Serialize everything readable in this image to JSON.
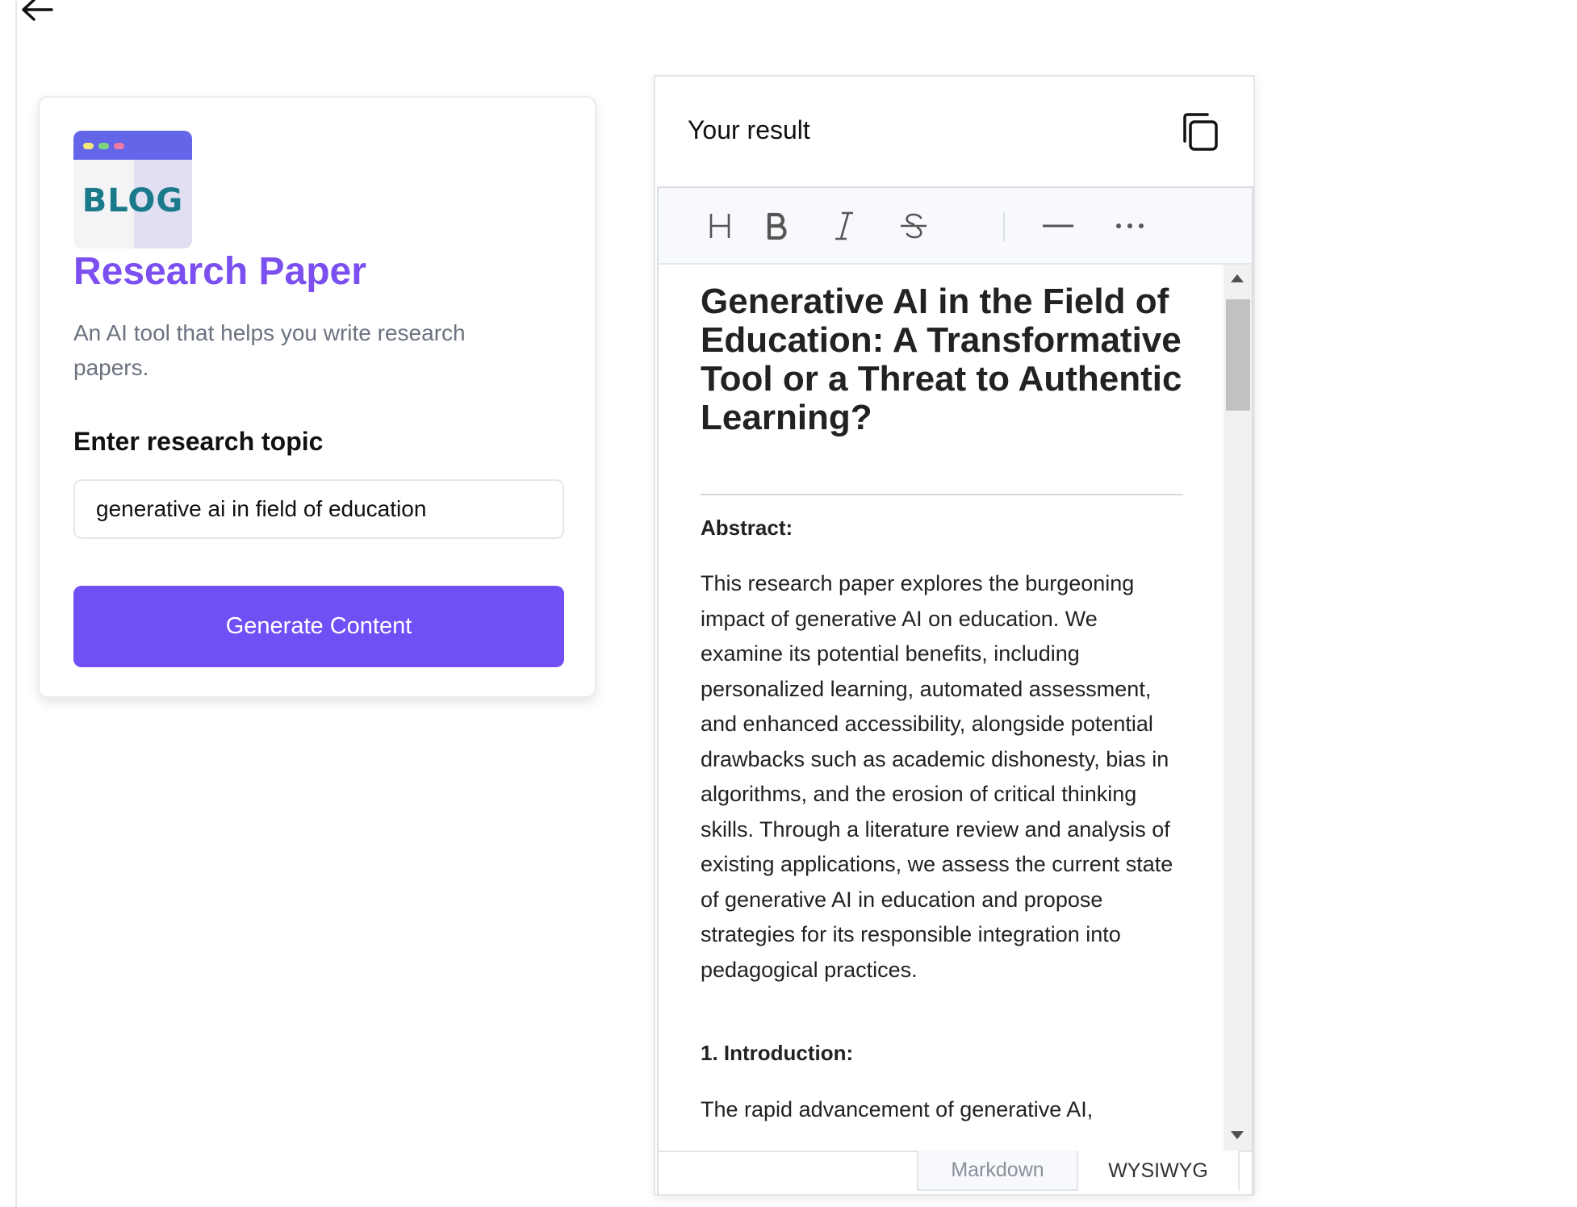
{
  "nav": {
    "back_icon": "arrow-left-icon"
  },
  "tool": {
    "logo_text": "BLOG",
    "title": "Research Paper",
    "description": "An AI tool that helps you write research papers.",
    "field_label": "Enter research topic",
    "field_value": "generative ai in field of education",
    "generate_label": "Generate Content",
    "colors": {
      "accent": "#7050f5",
      "title": "#7b4ff0"
    }
  },
  "result": {
    "title": "Your result",
    "copy_icon": "copy-icon",
    "toolbar": [
      "heading-icon",
      "bold-icon",
      "italic-icon",
      "strikethrough-icon",
      "horizontal-rule-icon",
      "more-icon"
    ],
    "document": {
      "heading": "Generative AI in the Field of Education: A Transformative Tool or a Threat to Authentic Learning?",
      "abstract_heading": "Abstract:",
      "abstract_body": "This research paper explores the burgeoning impact of generative AI on education.  We examine its potential benefits, including personalized learning, automated assessment, and enhanced accessibility, alongside potential drawbacks such as academic dishonesty, bias in algorithms, and the erosion of critical thinking skills.  Through a literature review and analysis of existing applications, we assess the current state of generative AI in education and propose strategies for its responsible integration into pedagogical practices.",
      "intro_heading": "1. Introduction:",
      "intro_body": "The rapid advancement of generative AI,"
    },
    "tabs": {
      "markdown": "Markdown",
      "wysiwyg": "WYSIWYG",
      "active": "WYSIWYG"
    }
  }
}
